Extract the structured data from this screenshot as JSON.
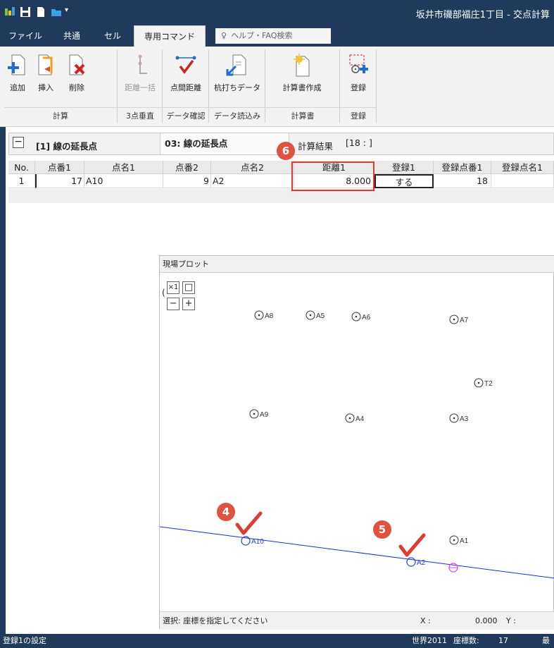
{
  "window": {
    "title": "坂井市磯部福庄1丁目 - 交点計算"
  },
  "menu": {
    "tabs": [
      "ファイル",
      "共通",
      "セル",
      "専用コマンド"
    ],
    "active_tab": "専用コマンド",
    "help_placeholder": "ヘルプ・FAQ検索"
  },
  "ribbon": {
    "buttons": [
      {
        "label": "追加",
        "icon": "add-doc-icon"
      },
      {
        "label": "挿入",
        "icon": "insert-doc-icon"
      },
      {
        "label": "削除",
        "icon": "delete-doc-icon"
      },
      {
        "label": "距離一括",
        "icon": "distance-batch-icon",
        "disabled": true
      },
      {
        "label": "点間距離",
        "icon": "point-distance-icon"
      },
      {
        "label": "杭打ちデータ",
        "icon": "stake-data-icon"
      },
      {
        "label": "計算書作成",
        "icon": "report-create-icon"
      },
      {
        "label": "登録",
        "icon": "register-icon"
      }
    ],
    "groups": [
      "計算",
      "3点垂直",
      "データ確認",
      "データ読込み",
      "計算書",
      "登録"
    ]
  },
  "panel": {
    "collapse_symbol": "−",
    "item_title": "[1] 線の延長点",
    "method": "03: 線の延長点",
    "result_label": "計算結果",
    "result_value": "[18 : ]"
  },
  "table": {
    "columns": [
      "No.",
      "点番1",
      "点名1",
      "点番2",
      "点名2",
      "距離1",
      "登録1",
      "登録点番1",
      "登録点名1"
    ],
    "rows": [
      {
        "no": "1",
        "pt1": "17",
        "name1": "A10",
        "pt2": "9",
        "name2": "A2",
        "dist1": "8.000",
        "reg1": "する",
        "regno": "18",
        "regname": ""
      }
    ]
  },
  "plot": {
    "title": "現場プロット",
    "tool_fit": "×1",
    "tool_rect": "□",
    "tool_minus": "−",
    "tool_plus": "+",
    "points": [
      "A8",
      "A5",
      "A6",
      "A7",
      "T2",
      "A9",
      "A4",
      "A3",
      "A10",
      "A2",
      "A1"
    ],
    "status_select": "選択: 座標を指定してください",
    "x_label": "X :",
    "x_value": "0.000",
    "y_label": "Y :"
  },
  "statusbar": {
    "left": "登録1の設定",
    "system": "世界2011",
    "count_label": "座標数:",
    "count": "17",
    "right": "最"
  },
  "callouts": [
    "4",
    "5",
    "6"
  ],
  "colors": {
    "chrome": "#1f3a5a",
    "callout": "#e0523f",
    "highlight_box": "#e03b30",
    "line": "#1a2fd6",
    "selected_point": "#2244cc",
    "new_point": "#e040e0"
  }
}
